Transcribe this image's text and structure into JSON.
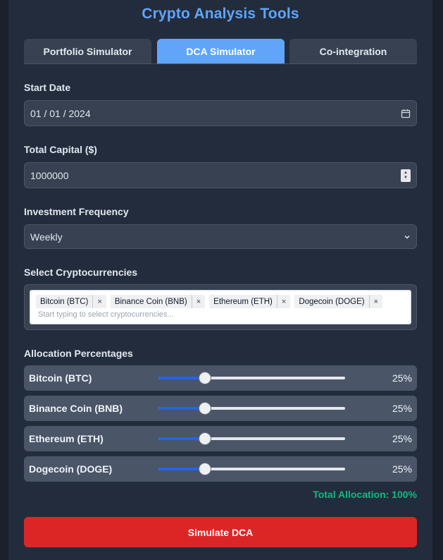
{
  "app": {
    "title": "Crypto Analysis Tools"
  },
  "tabs": [
    {
      "label": "Portfolio Simulator",
      "active": false
    },
    {
      "label": "DCA Simulator",
      "active": true
    },
    {
      "label": "Co-integration",
      "active": false
    }
  ],
  "form": {
    "start_date": {
      "label": "Start Date",
      "value": "01 / 01 / 2024",
      "icon": "calendar-icon"
    },
    "total_capital": {
      "label": "Total Capital ($)",
      "value": "1000000"
    },
    "frequency": {
      "label": "Investment Frequency",
      "value": "Weekly"
    },
    "cryptos": {
      "label": "Select Cryptocurrencies",
      "selected": [
        {
          "label": "Bitcoin (BTC)",
          "remove": "×"
        },
        {
          "label": "Binance Coin (BNB)",
          "remove": "×"
        },
        {
          "label": "Ethereum (ETH)",
          "remove": "×"
        },
        {
          "label": "Dogecoin (DOGE)",
          "remove": "×"
        }
      ],
      "placeholder": "Start typing to select cryptocurrencies..."
    }
  },
  "allocation": {
    "label": "Allocation Percentages",
    "items": [
      {
        "name": "Bitcoin (BTC)",
        "percent_label": "25%",
        "value": 25
      },
      {
        "name": "Binance Coin (BNB)",
        "percent_label": "25%",
        "value": 25
      },
      {
        "name": "Ethereum (ETH)",
        "percent_label": "25%",
        "value": 25
      },
      {
        "name": "Dogecoin (DOGE)",
        "percent_label": "25%",
        "value": 25
      }
    ],
    "total_label": "Total Allocation: 100%"
  },
  "actions": {
    "simulate_label": "Simulate DCA"
  },
  "colors": {
    "accent": "#60a5fa",
    "button": "#dc2626",
    "success": "#10b981",
    "slider_fill": "#2563eb"
  }
}
